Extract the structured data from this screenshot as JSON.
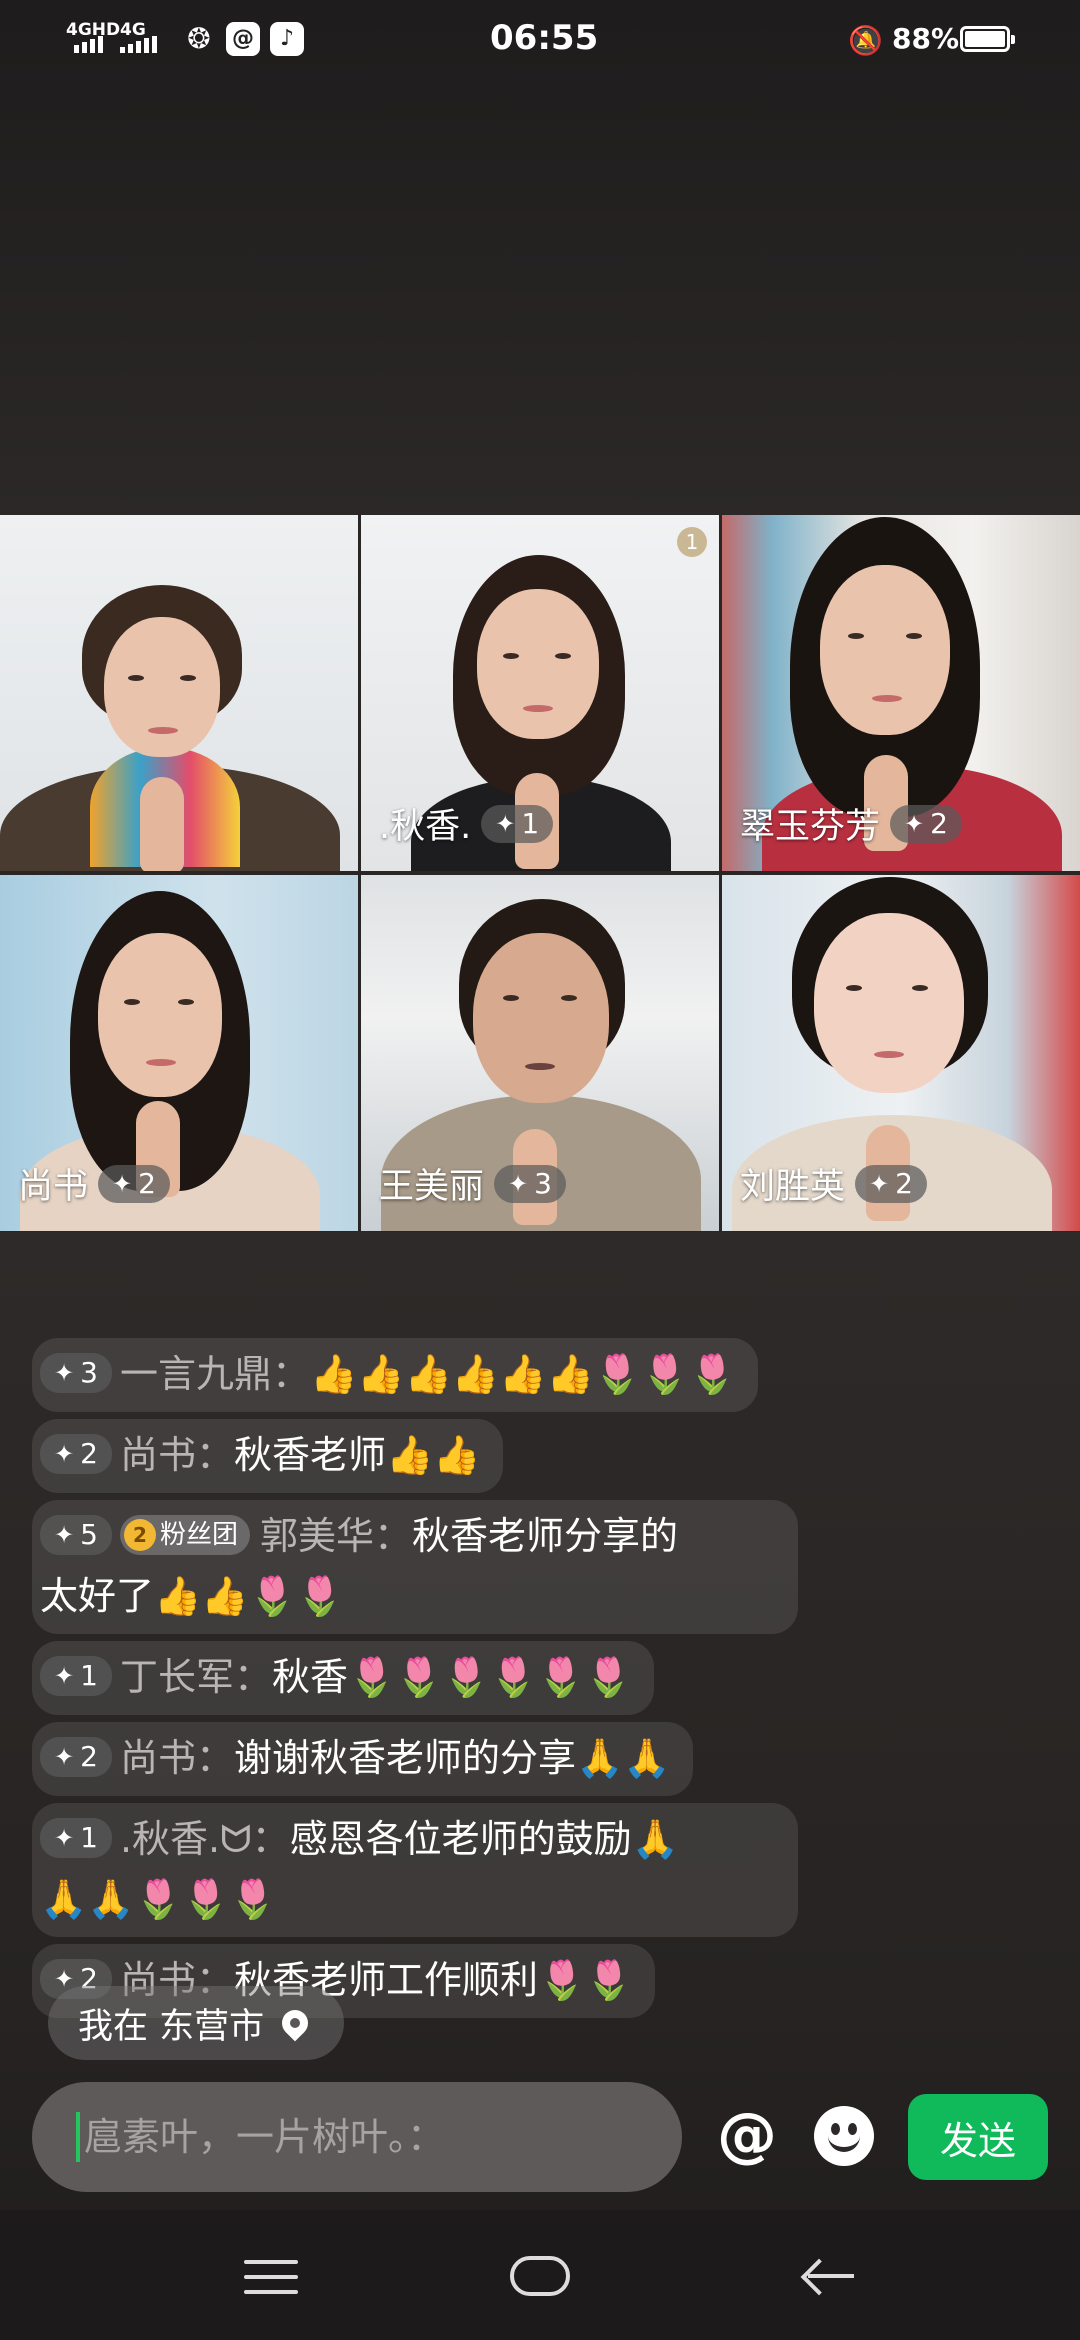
{
  "status_bar": {
    "signal1": "4GHD",
    "signal2": "4G",
    "time": "06:55",
    "battery": "88%"
  },
  "participants": [
    {
      "name": "",
      "level": ""
    },
    {
      "name": ".秋香.",
      "level": "1",
      "rank": "1"
    },
    {
      "name": "翠玉芬芳",
      "level": "2"
    },
    {
      "name": "尚书",
      "level": "2"
    },
    {
      "name": "王美丽",
      "level": "3"
    },
    {
      "name": "刘胜英",
      "level": "2"
    }
  ],
  "comments": [
    {
      "level": "3",
      "user": "一言九鼎：",
      "text": "👍👍👍👍👍👍🌷🌷🌷"
    },
    {
      "level": "2",
      "user": "尚书：",
      "text": "秋香老师👍👍"
    },
    {
      "level": "5",
      "badge_num": "2",
      "badge": "粉丝团",
      "user": "郭美华：",
      "text": "秋香老师分享的",
      "text2": "太好了👍👍🌷🌷"
    },
    {
      "level": "1",
      "user": "丁长军：",
      "text": "秋香🌷🌷🌷🌷🌷🌷"
    },
    {
      "level": "2",
      "user": "尚书：",
      "text": "谢谢秋香老师的分享🙏🙏"
    },
    {
      "level": "1",
      "user": ".秋香.ᗢ：",
      "text": "感恩各位老师的鼓励🙏",
      "text2": "🙏🙏🌷🌷🌷"
    },
    {
      "level": "2",
      "user": "尚书：",
      "text": "秋香老师工作顺利🌷🌷"
    }
  ],
  "location": {
    "label": "我在 东营市"
  },
  "input": {
    "placeholder": "扈素叶，一片树叶。："
  },
  "actions": {
    "at": "@",
    "send": "发送"
  }
}
